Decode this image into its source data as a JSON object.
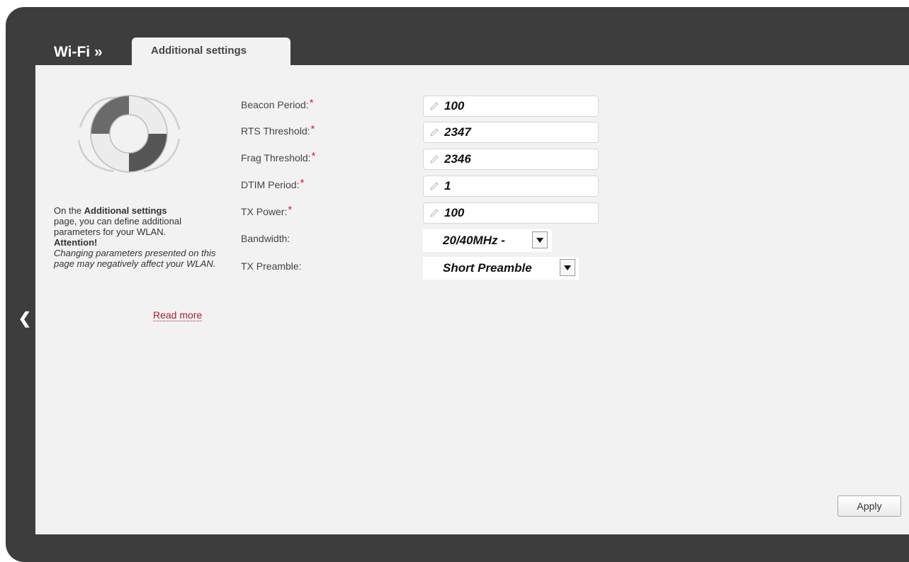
{
  "header": {
    "breadcrumb_root": "Wi-Fi »",
    "tab_label": "Additional settings"
  },
  "help": {
    "line1_prefix": "On the ",
    "line1_bold": "Additional settings",
    "line2": "page, you can define additional parameters for your WLAN.",
    "attention": "Attention!",
    "warning": "Changing parameters presented on this page may negatively affect your WLAN.",
    "read_more": "Read more"
  },
  "form": {
    "required_mark": "*",
    "beacon_period": {
      "label": "Beacon Period:",
      "value": "100"
    },
    "rts_threshold": {
      "label": "RTS Threshold:",
      "value": "2347"
    },
    "frag_threshold": {
      "label": "Frag Threshold:",
      "value": "2346"
    },
    "dtim_period": {
      "label": "DTIM Period:",
      "value": "1"
    },
    "tx_power": {
      "label": "TX Power:",
      "value": "100"
    },
    "bandwidth": {
      "label": "Bandwidth:",
      "value": "20/40MHz -"
    },
    "tx_preamble": {
      "label": "TX Preamble:",
      "value": "Short Preamble"
    }
  },
  "actions": {
    "apply": "Apply"
  },
  "icons": {
    "collapse": "chevron-left-icon",
    "help_illustration": "lifebuoy-icon",
    "edit": "pencil-icon",
    "dropdown": "chevron-down-icon"
  },
  "colors": {
    "frame": "#3d3d3d",
    "panel": "#f2f2f2",
    "required": "#e31b23",
    "link": "#a8202b"
  }
}
